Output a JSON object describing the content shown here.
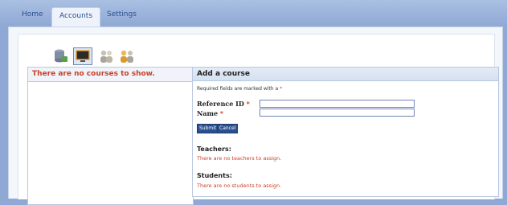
{
  "nav": {
    "tabs": [
      {
        "label": "Home",
        "active": false
      },
      {
        "label": "Accounts",
        "active": true
      },
      {
        "label": "Settings",
        "active": false
      }
    ]
  },
  "toolbar": {
    "icons": [
      "database-icon",
      "monitor-icon",
      "users-icon",
      "people-icon"
    ]
  },
  "left_panel": {
    "header": "There are no courses to show."
  },
  "form": {
    "title": "Add a course",
    "required_note": "Required fields are marked with a ",
    "required_mark": "*",
    "fields": [
      {
        "label": "Reference ID",
        "value": ""
      },
      {
        "label": "Name",
        "value": ""
      }
    ],
    "buttons": {
      "submit": "Submit",
      "cancel": "Cancel"
    },
    "teachers": {
      "heading": "Teachers:",
      "note": "There are no teachers to assign."
    },
    "students": {
      "heading": "Students:",
      "note": "There are no students to assign."
    }
  },
  "colors": {
    "accent": "#2a4f8f",
    "error": "#c8412a",
    "background": "#8fa9d4"
  }
}
